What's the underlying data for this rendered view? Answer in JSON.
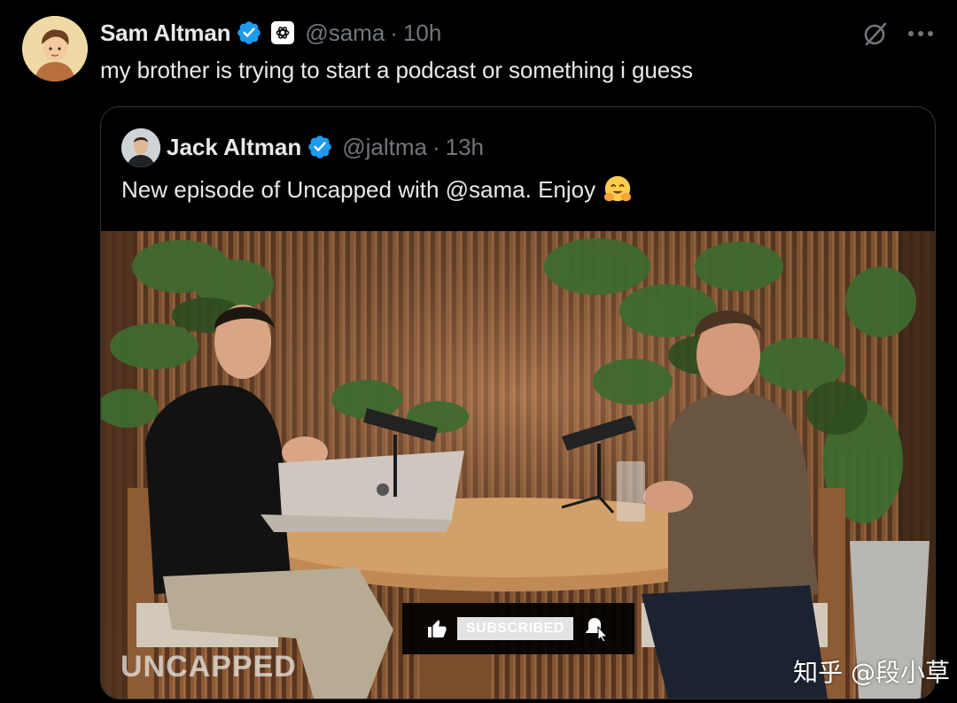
{
  "tweet": {
    "author_name": "Sam Altman",
    "handle": "@sama",
    "separator": "·",
    "time": "10h",
    "text": "my brother is trying to start a podcast or something i guess",
    "verified_icon": "verified-badge-icon",
    "affiliation_icon": "openai-logo-icon"
  },
  "actions": {
    "grok_icon": "grok-icon",
    "more_icon": "more-dots-icon"
  },
  "quote": {
    "author_name": "Jack Altman",
    "handle": "@jaltma",
    "separator": "·",
    "time": "13h",
    "text": "New episode of Uncapped with @sama. Enjoy",
    "emoji": "hugging-face-emoji"
  },
  "media": {
    "show_title": "UNCAPPED",
    "subscribe_label": "SUBSCRIBED",
    "watermark": "知乎 @段小草"
  },
  "colors": {
    "background": "#000000",
    "text_primary": "#e7e9ea",
    "text_secondary": "#71767b",
    "border": "#2f3336",
    "verified_blue": "#1d9bf0"
  }
}
